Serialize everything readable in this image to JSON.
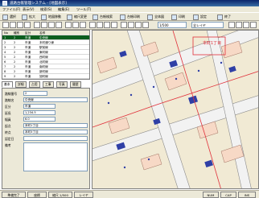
{
  "window": {
    "title": "道路台帳管理システム - [地図表示]"
  },
  "menu": [
    "ファイル(F)",
    "表示(V)",
    "検索(S)",
    "編集(E)",
    "ツール(T)"
  ],
  "toolbar1": [
    "選択",
    "拡大",
    "地図移動",
    "縮尺変更",
    "台帳検索",
    "台帳印刷",
    "全体図",
    "印刷",
    "設定",
    "終了"
  ],
  "toolbar2": {
    "scale_value": "1/500",
    "layer_value": "全レイヤ"
  },
  "grid": {
    "columns": [
      "No",
      "種別",
      "区分",
      "名称"
    ],
    "rows": [
      {
        "cells": [
          "1",
          "2",
          "市道",
          "中央線"
        ],
        "selected": true
      },
      {
        "cells": [
          "2",
          "2",
          "市道",
          "本町通り線"
        ],
        "selected": false
      },
      {
        "cells": [
          "3",
          "2",
          "市道",
          "駅前線"
        ],
        "selected": false
      },
      {
        "cells": [
          "4",
          "2",
          "市道",
          "東町線"
        ],
        "selected": false
      },
      {
        "cells": [
          "5",
          "2",
          "市道",
          "西町線"
        ],
        "selected": false
      },
      {
        "cells": [
          "6",
          "2",
          "市道",
          "北町線"
        ],
        "selected": false
      },
      {
        "cells": [
          "7",
          "2",
          "市道",
          "南町線"
        ],
        "selected": false
      },
      {
        "cells": [
          "8",
          "2",
          "市道",
          "新町線"
        ],
        "selected": false
      },
      {
        "cells": [
          "9",
          "2",
          "市道",
          "旭町線"
        ],
        "selected": false
      }
    ]
  },
  "tabs": [
    "基本",
    "詳細",
    "占用",
    "工事",
    "写真",
    "履歴"
  ],
  "form": {
    "fields": [
      {
        "label": "路線番号",
        "value": "2"
      },
      {
        "label": "路線名",
        "value": "中央線"
      },
      {
        "label": "区分",
        "value": "市道"
      },
      {
        "label": "延長",
        "value": "1,234.5"
      },
      {
        "label": "幅員",
        "value": "6.0"
      },
      {
        "label": "起点",
        "value": "本町1丁目"
      },
      {
        "label": "終点",
        "value": "本町3丁目"
      },
      {
        "label": "認定日",
        "value": ""
      },
      {
        "label": "備考",
        "value": ""
      }
    ]
  },
  "map": {
    "label": "本町1丁目"
  },
  "status": [
    "準備完了",
    "座標",
    "縮尺 1/500",
    "レイヤ",
    "NUM",
    "CAP",
    "INS"
  ],
  "colors": {
    "selected_row": "#0b5d1e",
    "map_red_line": "#e0303a",
    "building_blue": "#2f3fa6"
  }
}
